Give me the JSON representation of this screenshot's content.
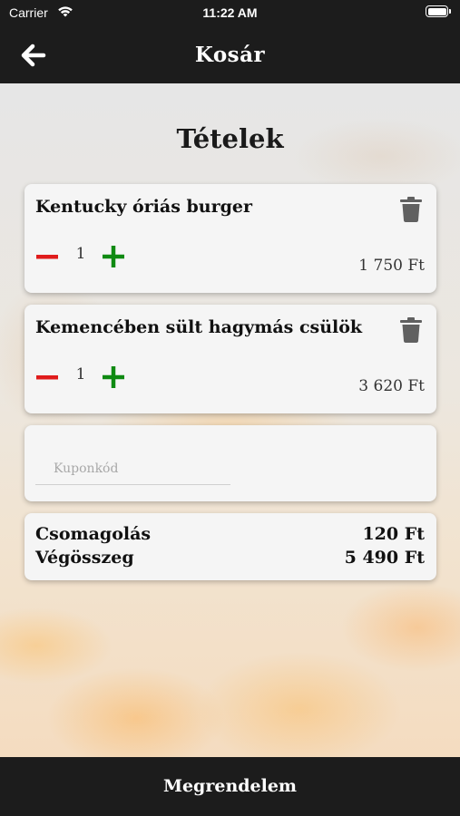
{
  "status_bar": {
    "carrier": "Carrier",
    "time": "11:22 AM"
  },
  "header": {
    "title": "Kosár",
    "back_icon": "arrow-left-icon"
  },
  "main": {
    "section_title": "Tételek",
    "items": [
      {
        "name": "Kentucky óriás burger",
        "quantity": "1",
        "price": "1 750 Ft"
      },
      {
        "name": "Kemencében sült hagymás csülök",
        "quantity": "1",
        "price": "3 620 Ft"
      }
    ],
    "coupon": {
      "placeholder": "Kuponkód",
      "value": ""
    },
    "summary": {
      "packaging_label": "Csomagolás",
      "packaging_value": "120 Ft",
      "total_label": "Végösszeg",
      "total_value": "5 490 Ft"
    }
  },
  "footer": {
    "order_label": "Megrendelem"
  },
  "colors": {
    "bar_background": "#1c1c1c",
    "minus": "#e01b1b",
    "plus": "#0f8a12",
    "trash": "#606060",
    "card": "#f5f5f5"
  }
}
